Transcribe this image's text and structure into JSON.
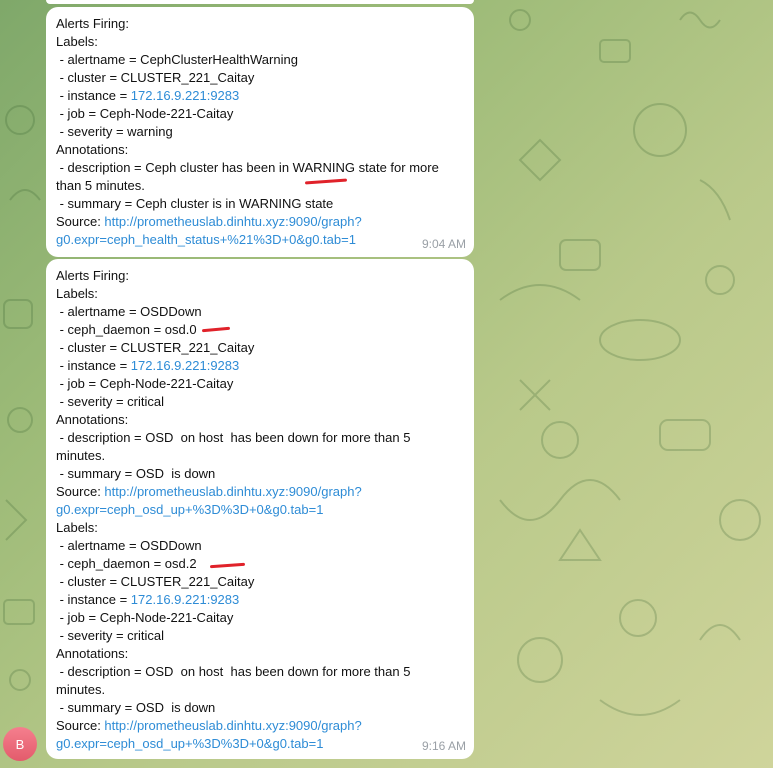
{
  "messages": [
    {
      "lines": [
        {
          "t": "Alerts Firing:"
        },
        {
          "t": "Labels:"
        },
        {
          "t": " - alertname = CephClusterHealthWarning"
        },
        {
          "t": " - cluster = CLUSTER_221_Caitay"
        },
        {
          "t": " - instance = ",
          "link": "172.16.9.221:9283"
        },
        {
          "t": " - job = Ceph-Node-221-Caitay"
        },
        {
          "t": " - severity = warning"
        },
        {
          "t": "Annotations:"
        },
        {
          "t": " - description = Ceph cluster has been in WARNING state for more"
        },
        {
          "t": "than 5 minutes."
        },
        {
          "t": " - summary = Ceph cluster is in WARNING state"
        },
        {
          "t": "Source: ",
          "link": "http://prometheuslab.dinhtu.xyz:9090/graph?"
        },
        {
          "t": "",
          "link": "g0.expr=ceph_health_status+%21%3D+0&g0.tab=1"
        }
      ],
      "time": "9:04 AM"
    },
    {
      "lines": [
        {
          "t": "Alerts Firing:"
        },
        {
          "t": "Labels:"
        },
        {
          "t": " - alertname = OSDDown"
        },
        {
          "t": " - ceph_daemon = osd.0"
        },
        {
          "t": " - cluster = CLUSTER_221_Caitay"
        },
        {
          "t": " - instance = ",
          "link": "172.16.9.221:9283"
        },
        {
          "t": " - job = Ceph-Node-221-Caitay"
        },
        {
          "t": " - severity = critical"
        },
        {
          "t": "Annotations:"
        },
        {
          "t": " - description = OSD  on host  has been down for more than 5"
        },
        {
          "t": "minutes."
        },
        {
          "t": " - summary = OSD  is down"
        },
        {
          "t": "Source: ",
          "link": "http://prometheuslab.dinhtu.xyz:9090/graph?"
        },
        {
          "t": "",
          "link": "g0.expr=ceph_osd_up+%3D%3D+0&g0.tab=1"
        },
        {
          "t": "Labels:"
        },
        {
          "t": " - alertname = OSDDown"
        },
        {
          "t": " - ceph_daemon = osd.2"
        },
        {
          "t": " - cluster = CLUSTER_221_Caitay"
        },
        {
          "t": " - instance = ",
          "link": "172.16.9.221:9283"
        },
        {
          "t": " - job = Ceph-Node-221-Caitay"
        },
        {
          "t": " - severity = critical"
        },
        {
          "t": "Annotations:"
        },
        {
          "t": " - description = OSD  on host  has been down for more than 5"
        },
        {
          "t": "minutes."
        },
        {
          "t": " - summary = OSD  is down"
        },
        {
          "t": "Source: ",
          "link": "http://prometheuslab.dinhtu.xyz:9090/graph?"
        },
        {
          "t": "",
          "link": "g0.expr=ceph_osd_up+%3D%3D+0&g0.tab=1"
        }
      ],
      "time": "9:16 AM"
    }
  ],
  "avatar": {
    "initial": "B",
    "color": "#e8697a"
  },
  "colors": {
    "link": "#2e8cd6",
    "annotation": "#e0222a",
    "bubble": "#ffffff"
  }
}
